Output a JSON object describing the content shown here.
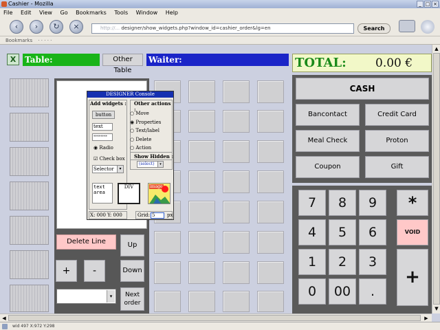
{
  "window": {
    "title": "Cashier - Mozilla"
  },
  "menu": [
    "File",
    "Edit",
    "View",
    "Go",
    "Bookmarks",
    "Tools",
    "Window",
    "Help"
  ],
  "address": {
    "blurred": "http://...",
    "path": "designer/show_widgets.php?window_id=cashier_order&lg=en"
  },
  "search_label": "Search",
  "bookmarks": {
    "first": "Bookmarks",
    "rest": "· · · · ·"
  },
  "top": {
    "close_mark": "X",
    "table_label": "Table:",
    "other_table": "Other Table",
    "waiter_label": "Waiter:"
  },
  "total": {
    "label": "TOTAL:",
    "amount": "0.00 €"
  },
  "payments": {
    "cash": "CASH",
    "bancontact": "Bancontact",
    "credit_card": "Credit Card",
    "meal_check": "Meal Check",
    "proton": "Proton",
    "coupon": "Coupon",
    "gift": "Gift"
  },
  "keypad": {
    "k7": "7",
    "k8": "8",
    "k9": "9",
    "star": "*",
    "k4": "4",
    "k5": "5",
    "k6": "6",
    "void": "VOID",
    "k1": "1",
    "k2": "2",
    "k3": "3",
    "plus": "+",
    "k0": "0",
    "k00": "00",
    "dot": "."
  },
  "order": {
    "delete_line": "Delete Line",
    "up": "Up",
    "down": "Down",
    "plus": "+",
    "minus": "-",
    "next_order_1": "Next",
    "next_order_2": "order"
  },
  "designer": {
    "title": "DESIGNER Console",
    "add_widgets": "Add widgets :",
    "button": "button",
    "text": "text",
    "password": "********",
    "radio": "Radio",
    "checkbox": "Check box",
    "selector": "Selector",
    "textarea_1": "text",
    "textarea_2": "area",
    "div": "DIV",
    "image": "image",
    "other_actions": "Other actions :",
    "actions": [
      "Move",
      "Properties",
      "Text/label",
      "Delete",
      "Action"
    ],
    "show_hidden": "Show Hidden :",
    "select": "(select)",
    "coords": "X: 000 Y: 000",
    "grid_label": "Grid:",
    "grid_value": "5",
    "grid_unit": "px"
  },
  "status": {
    "text": "wid 497 X:972 Y:298"
  }
}
